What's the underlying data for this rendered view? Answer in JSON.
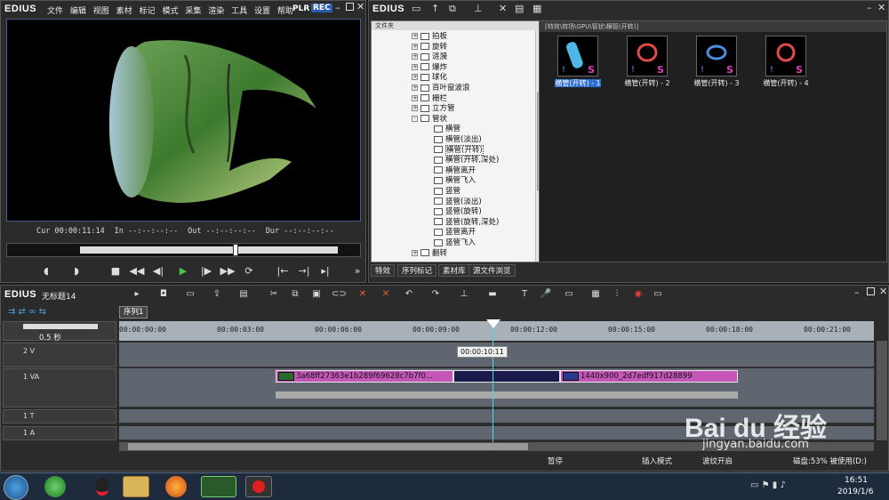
{
  "player": {
    "logo": "EDIUS",
    "menu": [
      "文件",
      "编辑",
      "视图",
      "素材",
      "标记",
      "模式",
      "采集",
      "渲染",
      "工具",
      "设置",
      "帮助"
    ],
    "mode_plr": "PLR",
    "mode_rec": "REC",
    "timecodes": {
      "cur": "Cur 00:00:11:14",
      "in": "In --:--:--:--",
      "out": "Out --:--:--:--",
      "dur": "Dur --:--:--:--"
    }
  },
  "bin": {
    "logo": "EDIUS",
    "tree_header": "文件夹",
    "tree_items": [
      {
        "label": "拍板",
        "expand": "+"
      },
      {
        "label": "旋转",
        "expand": "+"
      },
      {
        "label": "涟漪",
        "expand": "+"
      },
      {
        "label": "爆炸",
        "expand": "+"
      },
      {
        "label": "球化",
        "expand": "+"
      },
      {
        "label": "百叶窗波浪",
        "expand": "+"
      },
      {
        "label": "栅栏",
        "expand": "+"
      },
      {
        "label": "立方管",
        "expand": "+"
      },
      {
        "label": "管状",
        "expand": "-"
      },
      {
        "label": "横管",
        "expand": ""
      },
      {
        "label": "横管(淡出)",
        "expand": ""
      },
      {
        "label": "横管(开转)",
        "expand": "",
        "selected": true
      },
      {
        "label": "横管(开转,深处)",
        "expand": ""
      },
      {
        "label": "横管离开",
        "expand": ""
      },
      {
        "label": "横管飞入",
        "expand": ""
      },
      {
        "label": "竖管",
        "expand": ""
      },
      {
        "label": "竖管(淡出)",
        "expand": ""
      },
      {
        "label": "竖管(旋转)",
        "expand": ""
      },
      {
        "label": "竖管(旋转,深处)",
        "expand": ""
      },
      {
        "label": "竖管离开",
        "expand": ""
      },
      {
        "label": "竖管飞入",
        "expand": ""
      },
      {
        "label": "翻转",
        "expand": "+"
      }
    ],
    "path": "[特效\\转场\\GPU\\管状\\横管(开转)]",
    "assets": [
      {
        "label": "横管(开转) - 1",
        "selected": true
      },
      {
        "label": "横管(开转) - 2"
      },
      {
        "label": "横管(开转) - 3"
      },
      {
        "label": "横管(开转) - 4"
      }
    ],
    "tabs": [
      "特效",
      "序列标记",
      "素材库",
      "源文件浏览"
    ]
  },
  "timeline": {
    "logo": "EDIUS",
    "project": "无标题14",
    "sequence_tab": "序列1",
    "zoom": "0.5 秒",
    "ruler_ticks": [
      "00:00:00:00",
      "00:00:03:00",
      "00:00:06:00",
      "00:00:09:00",
      "00:00:12:00",
      "00:00:15:00",
      "00:00:18:00",
      "00:00:21:00"
    ],
    "hover_tooltip": "00:00:10:11",
    "tracks": [
      {
        "name": "2 V"
      },
      {
        "name": "1 VA"
      },
      {
        "name": "1 T"
      },
      {
        "name": "1 A"
      }
    ],
    "clip_a": "3a68ff27363e1b289f69628c7b7f0...",
    "clip_b": "1440x900_2d7edf917d28899",
    "status": {
      "state": "暂停",
      "mode": "插入模式",
      "ripple": "波纹开启",
      "disk": "磁盘:53% 被使用(D:)"
    }
  },
  "taskbar": {
    "time": "16:51",
    "date": "2019/1/6"
  },
  "watermark": {
    "brand": "Bai du 经验",
    "url": "jingyan.baidu.com"
  },
  "colors": {
    "accent": "#2d6fd0",
    "clip": "#c456b8",
    "rec": "#2a5db0"
  }
}
